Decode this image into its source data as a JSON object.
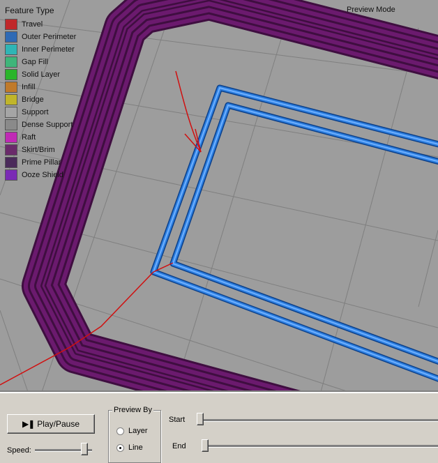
{
  "legend": {
    "title": "Feature Type",
    "items": [
      {
        "label": "Travel",
        "color": "#c0282a"
      },
      {
        "label": "Outer Perimeter",
        "color": "#2f6ab5"
      },
      {
        "label": "Inner Perimeter",
        "color": "#2fb5b5"
      },
      {
        "label": "Gap Fill",
        "color": "#3fb57a"
      },
      {
        "label": "Solid Layer",
        "color": "#2ab52a"
      },
      {
        "label": "Infill",
        "color": "#c07a2a"
      },
      {
        "label": "Bridge",
        "color": "#c0b52a"
      },
      {
        "label": "Support",
        "color": "#a5a5a5"
      },
      {
        "label": "Dense Support",
        "color": "#8a8a8a"
      },
      {
        "label": "Raft",
        "color": "#c02ab5"
      },
      {
        "label": "Skirt/Brim",
        "color": "#6a2a6a"
      },
      {
        "label": "Prime Pillar",
        "color": "#4a2a5a"
      },
      {
        "label": "Ooze Shield",
        "color": "#7a2ab5"
      }
    ]
  },
  "viewport": {
    "mode_label": "Preview Mode",
    "icons": [
      "grid-floor",
      "skirt-brim-path",
      "outer-perimeter-path",
      "travel-path"
    ]
  },
  "controls": {
    "play_pause_label": "Play/Pause",
    "play_pause_icon": "play-pause-icon",
    "speed_label": "Speed:",
    "preview_by": {
      "title": "Preview By",
      "options": [
        {
          "label": "Layer",
          "selected": false
        },
        {
          "label": "Line",
          "selected": true
        }
      ]
    },
    "start_label": "Start",
    "end_label": "End"
  }
}
